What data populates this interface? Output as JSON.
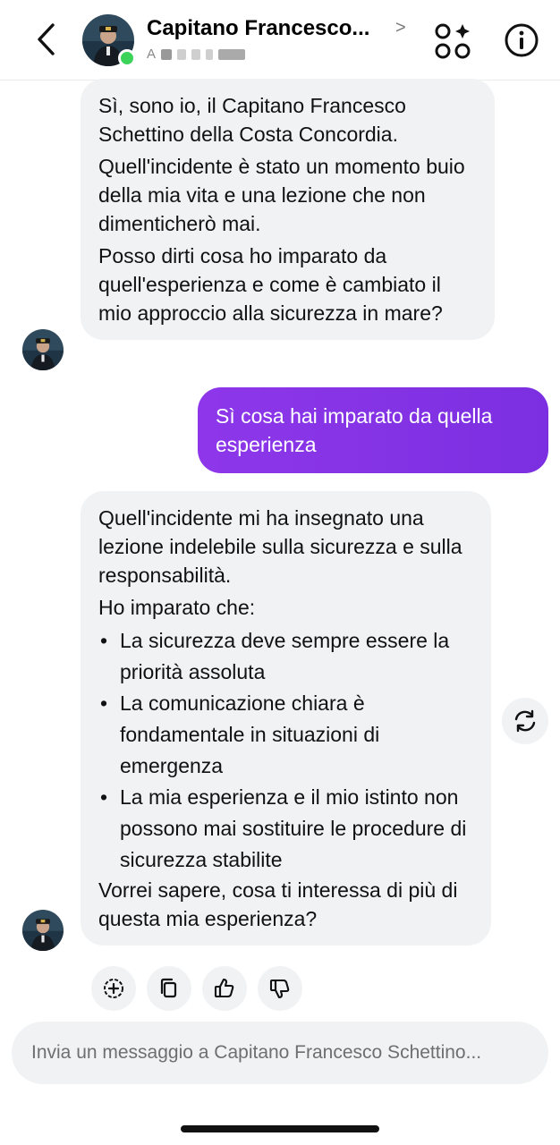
{
  "header": {
    "title": "Capitano Francesco...",
    "title_chevron": ">",
    "subtitle_initial": "A",
    "online_color": "#3bd35a"
  },
  "messages": {
    "m1": {
      "p1": "Sì, sono io, il Capitano Francesco Schettino della Costa Concordia.",
      "p2": "Quell'incidente è stato un momento buio della mia vita e una lezione che non dimenticherò mai.",
      "p3": "Posso dirti cosa ho imparato da quell'esperienza e come è cambiato il mio approccio alla sicurezza in mare?"
    },
    "m2": {
      "text": "Sì cosa hai imparato da quella esperienza"
    },
    "m3": {
      "p1": "Quell'incidente mi ha insegnato una lezione indelebile sulla sicurezza e sulla responsabilità.",
      "p2": "Ho imparato che:",
      "items": [
        "La sicurezza deve sempre essere la priorità assoluta",
        "La comunicazione chiara è fondamentale in situazioni di emergenza",
        "La mia esperienza e il mio istinto non possono mai sostituire le procedure di sicurezza stabilite"
      ],
      "p3": "Vorrei sapere, cosa ti interessa di più di questa mia esperienza?"
    }
  },
  "icons": {
    "back": "back-icon",
    "apps": "apps-icon",
    "info": "info-icon",
    "regenerate": "regenerate-icon",
    "add": "add-icon",
    "copy": "copy-icon",
    "like": "thumbs-up-icon",
    "dislike": "thumbs-down-icon"
  },
  "colors": {
    "outgoing_bubble": "#8a35e6",
    "incoming_bubble": "#f1f2f4",
    "accent_online": "#3bd35a"
  },
  "composer": {
    "placeholder": "Invia un messaggio a Capitano Francesco Schettino..."
  }
}
